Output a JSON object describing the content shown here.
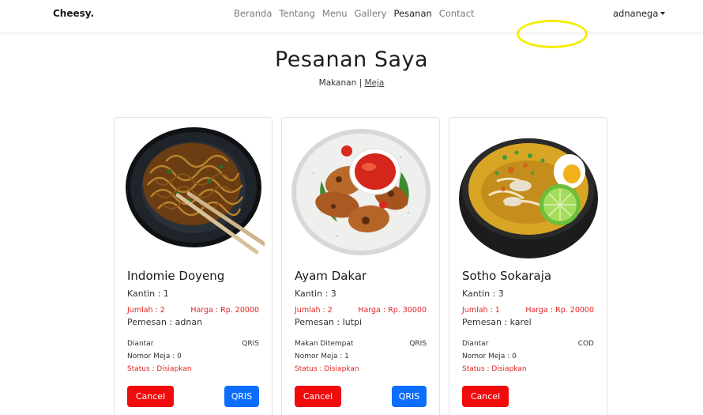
{
  "brand": "Cheesy.",
  "nav": [
    "Beranda",
    "Tentang",
    "Menu",
    "Gallery",
    "Pesanan",
    "Contact"
  ],
  "nav_active": "Pesanan",
  "user": "adnanega",
  "page": {
    "title": "Pesanan Saya",
    "sub_makanan": "Makanan",
    "sub_sep": " | ",
    "sub_meja": "Meja"
  },
  "colors": {
    "accent_red": "#e02424",
    "cancel_red": "#f00c0c",
    "qris_blue": "#0d6efd",
    "annotation_yellow": "#f6ee00"
  },
  "orders": [
    {
      "title": "Indomie Doyeng",
      "kantin": "Kantin : 1",
      "jumlah": "Jumlah : 2",
      "harga": "Harga : Rp. 20000",
      "pemesan": "Pemesan : adnan",
      "mode": "Diantar",
      "payment": "QRIS",
      "meja": "Nomor Meja : 0",
      "status": "Status : Disiapkan",
      "cancel_label": "Cancel",
      "pay_button": "QRIS",
      "image": "noodles-image"
    },
    {
      "title": "Ayam Dakar",
      "kantin": "Kantin : 3",
      "jumlah": "Jumlah : 2",
      "harga": "Harga : Rp. 30000",
      "pemesan": "Pemesan : lutpi",
      "mode": "Makan Ditempat",
      "payment": "QRIS",
      "meja": "Nomor Meja : 1",
      "status": "Status : Disiapkan",
      "cancel_label": "Cancel",
      "pay_button": "QRIS",
      "image": "chicken-image"
    },
    {
      "title": "Sotho Sokaraja",
      "kantin": "Kantin : 3",
      "jumlah": "Jumlah : 1",
      "harga": "Harga : Rp. 20000",
      "pemesan": "Pemesan : karel",
      "mode": "Diantar",
      "payment": "COD",
      "meja": "Nomor Meja : 0",
      "status": "Status : Disiapkan",
      "cancel_label": "Cancel",
      "image": "soup-image"
    }
  ]
}
